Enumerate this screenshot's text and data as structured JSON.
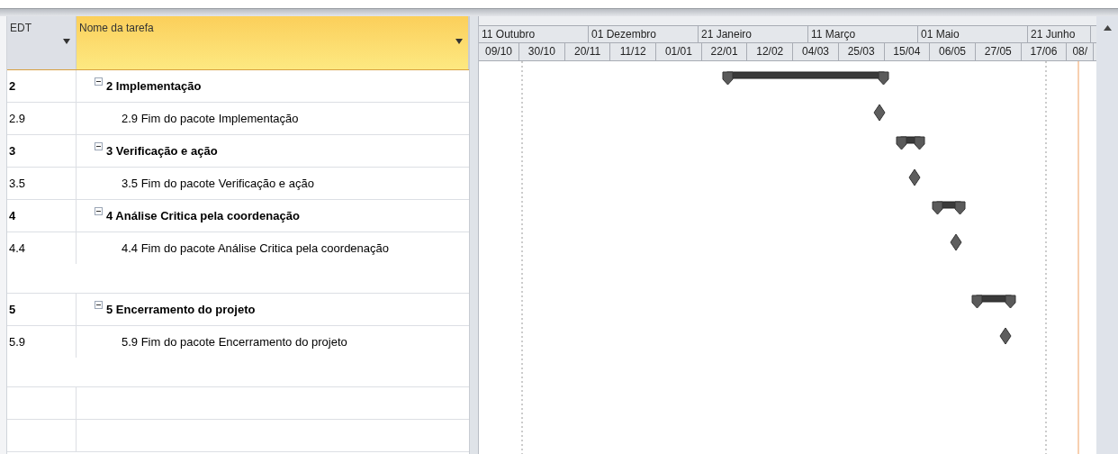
{
  "table": {
    "columns": [
      {
        "label": "EDT",
        "selected": false
      },
      {
        "label": "Nome da tarefa",
        "selected": true
      }
    ],
    "tasks": [
      {
        "edt": "2",
        "name": "2 Implementação",
        "expanded": true,
        "kind": "summary",
        "children": [
          {
            "edt": "2.9",
            "name": "2.9 Fim do pacote Implementação",
            "kind": "milestone"
          }
        ]
      },
      {
        "edt": "3",
        "name": "3 Verificação e ação",
        "expanded": true,
        "kind": "summary",
        "children": [
          {
            "edt": "3.5",
            "name": "3.5 Fim do pacote Verificação e ação",
            "kind": "milestone"
          }
        ]
      },
      {
        "edt": "4",
        "name": "4 Análise Critica pela coordenação",
        "expanded": true,
        "kind": "summary",
        "children": [
          {
            "edt": "4.4",
            "name": "4.4 Fim do pacote Análise Critica pela coordenação",
            "kind": "milestone"
          }
        ]
      },
      {
        "edt": "5",
        "name": "5 Encerramento do projeto",
        "expanded": true,
        "kind": "summary",
        "children": [
          {
            "edt": "5.9",
            "name": "5.9 Fim do pacote Encerramento do projeto",
            "kind": "milestone"
          }
        ]
      }
    ]
  },
  "timescale": {
    "major": [
      "11 Outubro",
      "01 Dezembro",
      "21 Janeiro",
      "11 Março",
      "01 Maio",
      "21 Junho"
    ],
    "minor": [
      "09/10",
      "30/10",
      "20/11",
      "11/12",
      "01/01",
      "22/01",
      "12/02",
      "04/03",
      "25/03",
      "15/04",
      "06/05",
      "27/05",
      "17/06",
      "08/"
    ]
  }
}
